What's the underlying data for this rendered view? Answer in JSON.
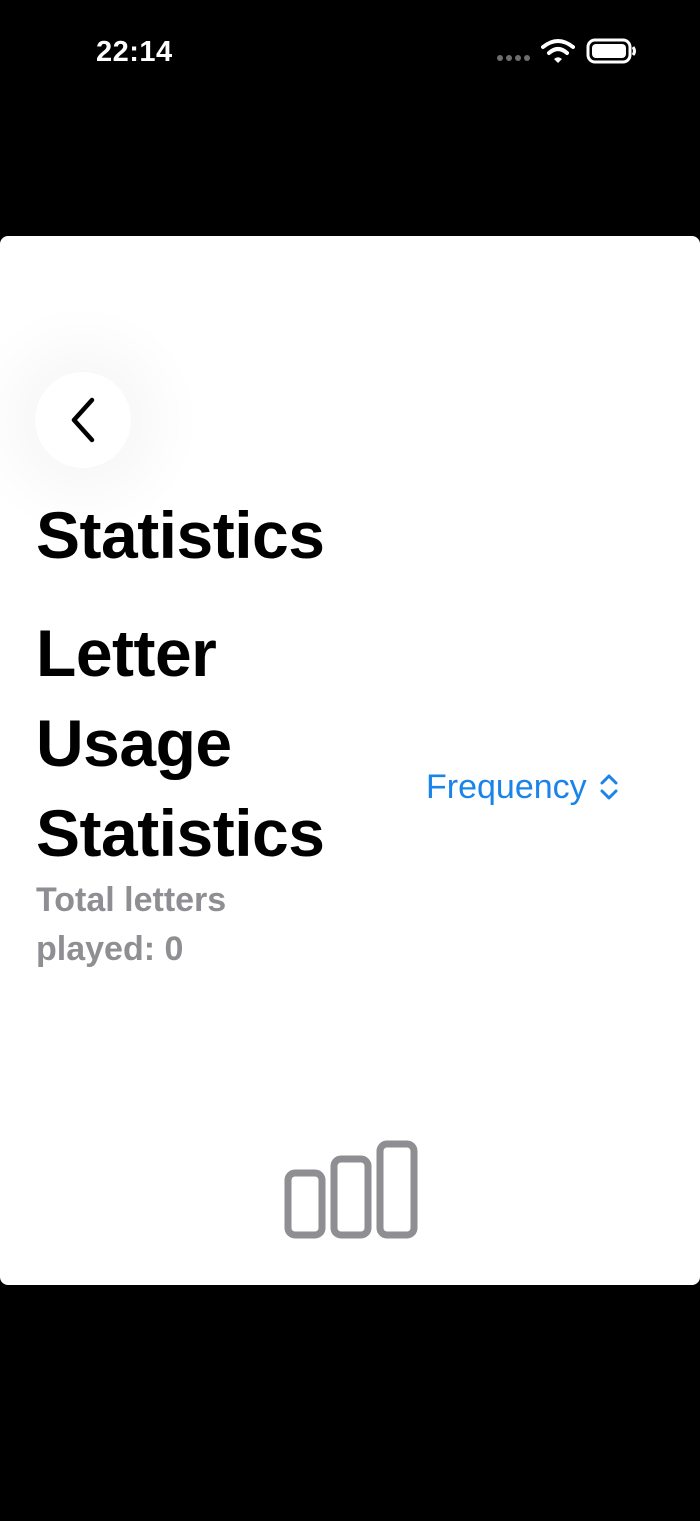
{
  "status_bar": {
    "time": "22:14",
    "icons": [
      "cellular-signal-icon",
      "wifi-icon",
      "battery-icon"
    ]
  },
  "navigation": {
    "back_icon": "chevron-left-icon"
  },
  "header": {
    "title": "Statistics"
  },
  "letter_usage": {
    "title": "Letter Usage Statistics",
    "total_letters_text": "Total letters played: 0",
    "sort_picker": {
      "selected": "Frequency",
      "icon": "chevron-up-down-icon"
    },
    "empty_state_icon": "bar-chart-icon"
  },
  "colors": {
    "accent": "#1a84e8",
    "secondary_text": "#8e8e93",
    "background": "#000000",
    "card": "#ffffff"
  }
}
